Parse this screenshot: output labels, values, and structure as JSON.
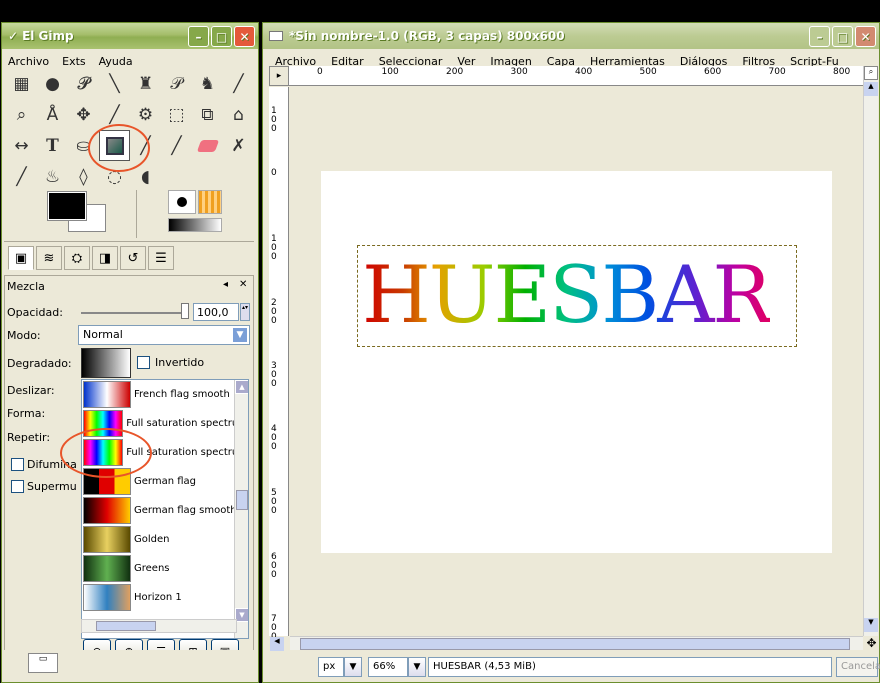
{
  "toolbox": {
    "title": "El Gimp",
    "menu": [
      "Archivo",
      "Exts",
      "Ayuda"
    ],
    "tools": [
      "▦",
      "●",
      "𝓟",
      "╲",
      "♜",
      "𝒫",
      "♞",
      "╱",
      "⌕",
      "Å",
      "✥",
      "╱",
      "⚙",
      "⬚",
      "⧉",
      "⌂",
      "↔",
      "T",
      "⛀",
      "",
      "╱",
      "╱",
      "◇",
      "✗",
      "╱",
      "♨",
      "◊",
      "◌",
      "◖"
    ],
    "dock_tabs": [
      "▣",
      "≋",
      "⛭",
      "◨",
      "↺",
      "☰"
    ],
    "panel_title": "Mezcla",
    "opacity_label": "Opacidad:",
    "opacity_value": "100,0",
    "mode_label": "Modo:",
    "mode_value": "Normal",
    "gradient_label": "Degradado:",
    "inverted_label": "Invertido",
    "offset_label": "Deslizar:",
    "shape_label": "Forma:",
    "repeat_label": "Repetir:",
    "dither_label": "Difumina",
    "supersample_label": "Supermu",
    "gradients": [
      {
        "name": "French flag smooth",
        "swatch": "linear-gradient(90deg,#0033cc,#ffffff,#cc0000)"
      },
      {
        "name": "Full saturation spectrum",
        "swatch": "linear-gradient(90deg,#ff0000,#ffff00,#00ff00,#00ffff,#0000ff,#ff00ff,#ff0000)"
      },
      {
        "name": "Full saturation spectrum",
        "swatch": "linear-gradient(90deg,#ff0000,#ff00ff,#0000ff,#00ffff,#00ff00,#ffff00,#ff0000)"
      },
      {
        "name": "German flag",
        "swatch": "linear-gradient(90deg,#000 33%,#e00000 33% 66%,#ffcc00 66%)"
      },
      {
        "name": "German flag smooth",
        "swatch": "linear-gradient(90deg,#000,#e00000,#ffcc00)"
      },
      {
        "name": "Golden",
        "swatch": "linear-gradient(90deg,#5a4a00,#e8d060,#5a4a00)"
      },
      {
        "name": "Greens",
        "swatch": "linear-gradient(90deg,#103010,#60b050,#103010)"
      },
      {
        "name": "Horizon 1",
        "swatch": "linear-gradient(90deg,#ffffff,#3080c0,#e0a060)"
      }
    ]
  },
  "image_window": {
    "title": "*Sin nombre-1.0 (RGB, 3 capas) 800x600",
    "menu": [
      "Archivo",
      "Editar",
      "Seleccionar",
      "Ver",
      "Imagen",
      "Capa",
      "Herramientas",
      "Diálogos",
      "Filtros",
      "Script-Fu"
    ],
    "ruler_h": [
      "0",
      "100",
      "200",
      "300",
      "400",
      "500",
      "600",
      "700",
      "800"
    ],
    "ruler_v": [
      "1\n0\n0",
      "0",
      "1\n0\n0",
      "2\n0\n0",
      "3\n0\n0",
      "4\n0\n0",
      "5\n0\n0",
      "6\n0\n0",
      "7\n0\n0"
    ],
    "canvas_text": "HUESBAR",
    "unit": "px",
    "zoom": "66%",
    "status": "HUESBAR (4,53 MiB)",
    "cancel": "Cancelar"
  }
}
